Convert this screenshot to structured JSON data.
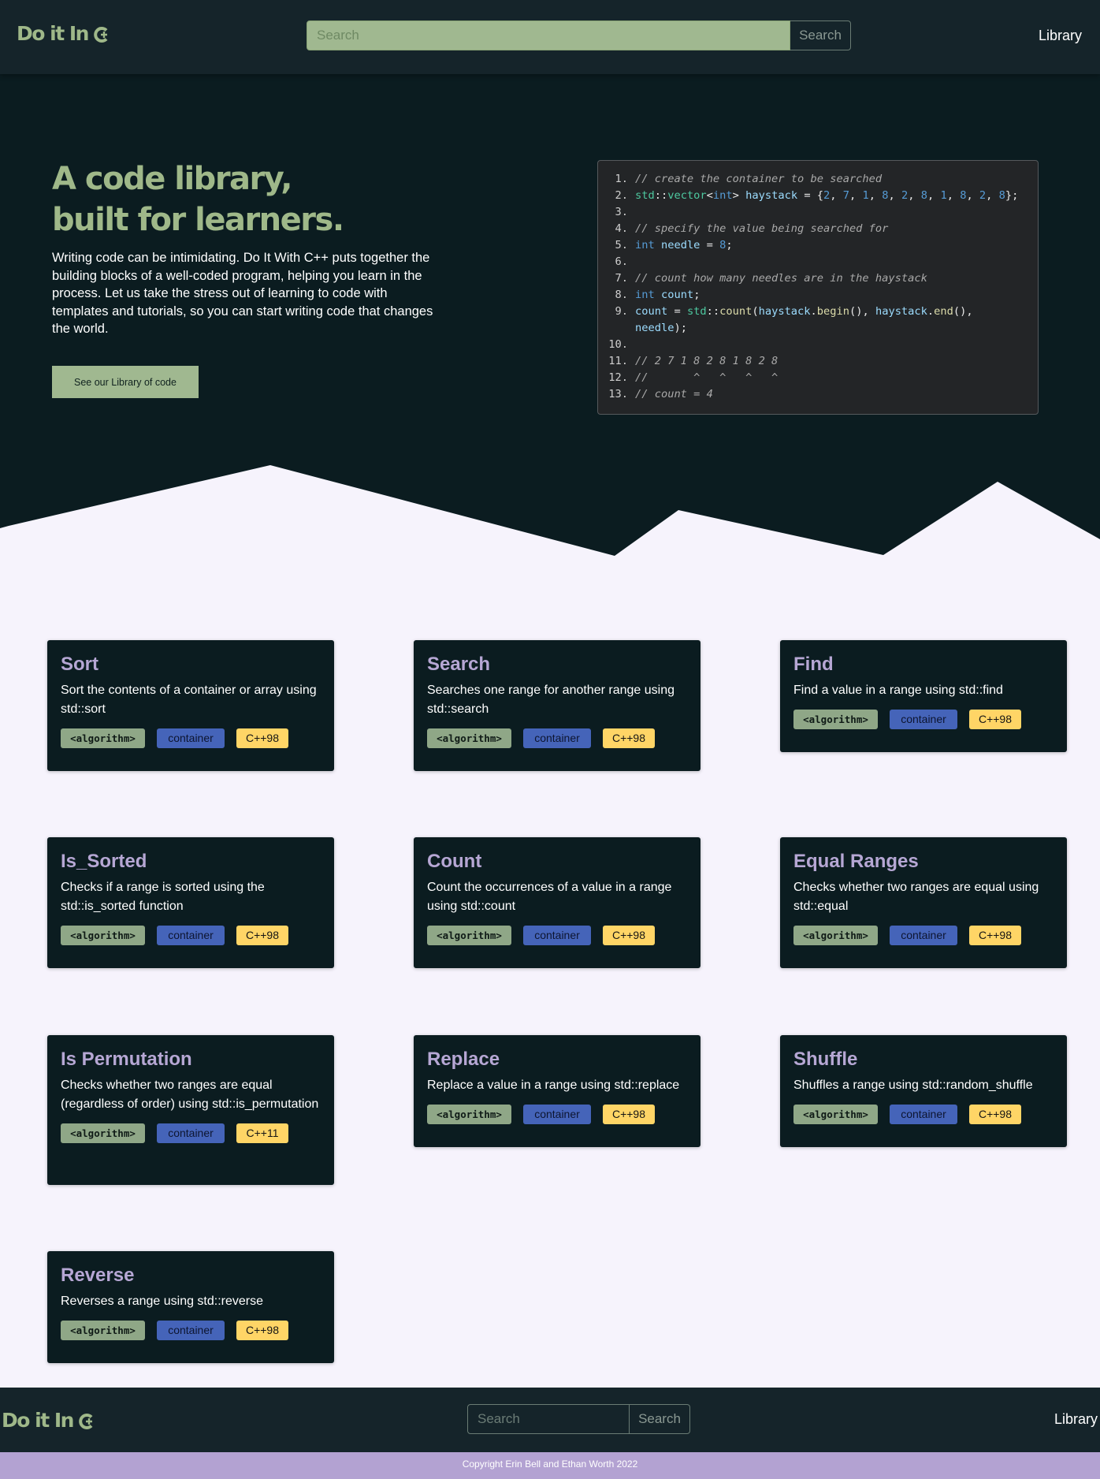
{
  "header": {
    "logo_text": "Do it In",
    "search_placeholder": "Search",
    "search_button": "Search",
    "nav_library": "Library"
  },
  "hero": {
    "title_line1": "A code library,",
    "title_line2": "built for learners.",
    "description": "Writing code can be intimidating. Do It With C++ puts together the building blocks of a well-coded program, helping you learn in the process. Let us take the stress out of learning to code with templates and tutorials, so you can start writing code that changes the world.",
    "cta_button": "See our Library of code"
  },
  "code": {
    "line_numbers": [
      "1.",
      "2.",
      "3.",
      "4.",
      "5.",
      "6.",
      "7.",
      "8.",
      "9.",
      "10.",
      "11.",
      "12.",
      "13."
    ],
    "lines": [
      "// create the container to be searched",
      "std::vector<int> haystack = {2, 7, 1, 8, 2, 8, 1, 8, 2, 8};",
      "",
      "// specify the value being searched for",
      "int needle = 8;",
      "",
      "// count how many needles are in the haystack",
      "int count;",
      "count = std::count(haystack.begin(), haystack.end(), needle);",
      "",
      "// 2 7 1 8 2 8 1 8 2 8",
      "//       ^   ^   ^   ^",
      "// count = 4"
    ]
  },
  "cards": [
    {
      "title": "Sort",
      "description": "Sort the contents of a container or array using std::sort",
      "tags": [
        "<algorithm>",
        "container",
        "C++98"
      ]
    },
    {
      "title": "Search",
      "description": "Searches one range for another range using std::search",
      "tags": [
        "<algorithm>",
        "container",
        "C++98"
      ]
    },
    {
      "title": "Find",
      "description": "Find a value in a range using std::find",
      "tags": [
        "<algorithm>",
        "container",
        "C++98"
      ]
    },
    {
      "title": "Is_Sorted",
      "description": "Checks if a range is sorted using the std::is_sorted function",
      "tags": [
        "<algorithm>",
        "container",
        "C++98"
      ]
    },
    {
      "title": "Count",
      "description": "Count the occurrences of a value in a range using std::count",
      "tags": [
        "<algorithm>",
        "container",
        "C++98"
      ]
    },
    {
      "title": "Equal Ranges",
      "description": "Checks whether two ranges are equal using std::equal",
      "tags": [
        "<algorithm>",
        "container",
        "C++98"
      ]
    },
    {
      "title": "Is Permutation",
      "description": "Checks whether two ranges are equal (regardless of order) using std::is_permutation",
      "tags": [
        "<algorithm>",
        "container",
        "C++11"
      ]
    },
    {
      "title": "Replace",
      "description": "Replace a value in a range using std::replace",
      "tags": [
        "<algorithm>",
        "container",
        "C++98"
      ]
    },
    {
      "title": "Shuffle",
      "description": "Shuffles a range using std::random_shuffle",
      "tags": [
        "<algorithm>",
        "container",
        "C++98"
      ]
    },
    {
      "title": "Reverse",
      "description": "Reverses a range using std::reverse",
      "tags": [
        "<algorithm>",
        "container",
        "C++98"
      ]
    }
  ],
  "footer": {
    "logo_text": "Do it In",
    "search_placeholder": "Search",
    "search_button": "Search",
    "nav_library": "Library",
    "copyright": "Copyright Erin Bell and Ethan Worth 2022"
  },
  "colors": {
    "accent_green": "#9fb889",
    "dark_bg": "#0b1c20",
    "header_bg": "#15242a",
    "title_purple": "#b6a7d4",
    "tag_algorithm": "#8fa787",
    "tag_container": "#4564b9",
    "tag_standard": "#ffd566",
    "footer_bar": "#b3a2d2"
  }
}
